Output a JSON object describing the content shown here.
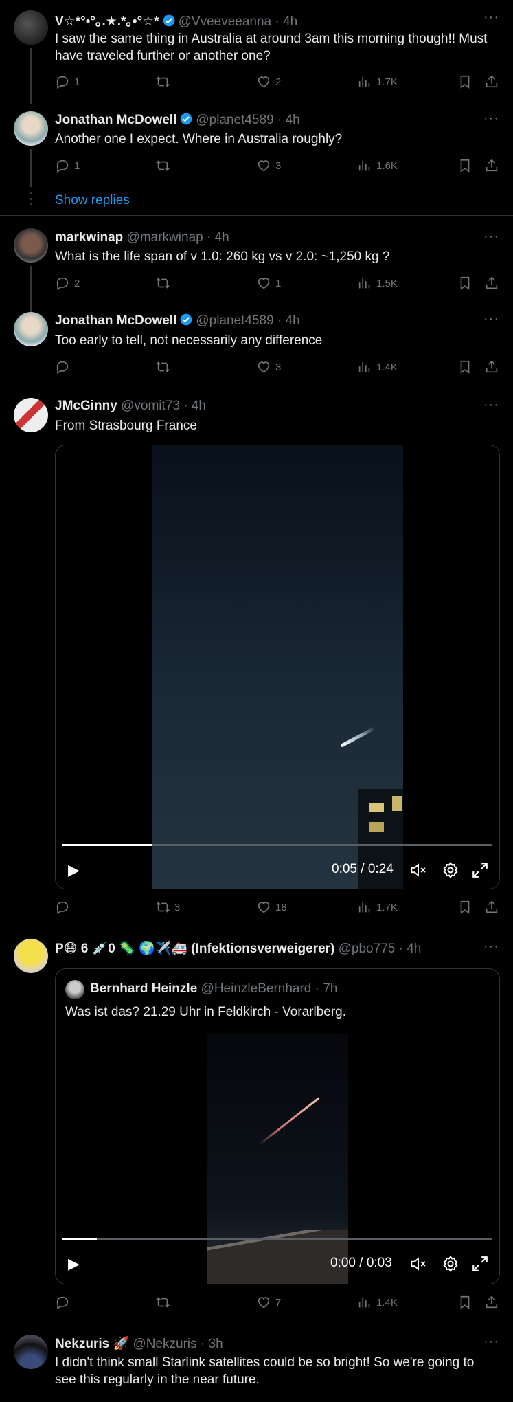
{
  "tweets": [
    {
      "name": "V☆*°•°｡.★.*｡•°☆*",
      "handle": "@Vveeveeanna",
      "time": "· 4h",
      "text": "I saw the same thing in Australia at around 3am this morning though!! Must have traveled further or another one?",
      "reply_count": "1",
      "retweet_count": "",
      "like_count": "2",
      "views": "1.7K"
    },
    {
      "name": "Jonathan McDowell",
      "handle": "@planet4589",
      "time": "· 4h",
      "text": "Another one I expect.  Where in Australia roughly?",
      "reply_count": "1",
      "retweet_count": "",
      "like_count": "3",
      "views": "1.6K"
    },
    {
      "name": "markwinap",
      "handle": "@markwinap",
      "time": "· 4h",
      "text": "What is the life span of v 1.0: 260 kg vs v 2.0: ~1,250 kg ?",
      "reply_count": "2",
      "retweet_count": "",
      "like_count": "1",
      "views": "1.5K"
    },
    {
      "name": "Jonathan McDowell",
      "handle": "@planet4589",
      "time": "· 4h",
      "text": "Too early to tell, not necessarily any difference",
      "reply_count": "",
      "retweet_count": "",
      "like_count": "3",
      "views": "1.4K"
    },
    {
      "name": "JMcGinny",
      "handle": "@vomit73",
      "time": "· 4h",
      "text": "From Strasbourg France",
      "video_time": "0:05 / 0:24",
      "video_progress": 0.21,
      "reply_count": "",
      "retweet_count": "3",
      "like_count": "18",
      "views": "1.7K"
    },
    {
      "name": "P😷 6 💉0 🦠 🌍✈️🚑 (Infektionsverweigerer)",
      "handle": "@pbo775",
      "time": "· 4h",
      "quote": {
        "name": "Bernhard Heinzle",
        "handle": "@HeinzleBernhard",
        "time": "· 7h",
        "text": "Was ist das? 21.29 Uhr in Feldkirch - Vorarlberg.",
        "video_time": "0:00 / 0:03",
        "video_progress": 0.08
      },
      "reply_count": "",
      "retweet_count": "",
      "like_count": "7",
      "views": "1.4K"
    },
    {
      "name": "Nekzuris 🚀",
      "handle": "@Nekzuris",
      "time": "· 3h",
      "text": "I didn't think small Starlink satellites could be so bright! So we're going to see this regularly in the near future."
    }
  ],
  "show_replies": "Show replies",
  "more_glyph": "···",
  "colors": {
    "accent": "#1d9bf0",
    "muted": "#71767b",
    "divider": "#2f3336"
  },
  "icons": [
    "reply-icon",
    "retweet-icon",
    "like-icon",
    "views-icon",
    "bookmark-icon",
    "share-icon",
    "verified-icon",
    "play-icon",
    "mute-icon",
    "settings-icon",
    "fullscreen-icon",
    "more-icon"
  ]
}
